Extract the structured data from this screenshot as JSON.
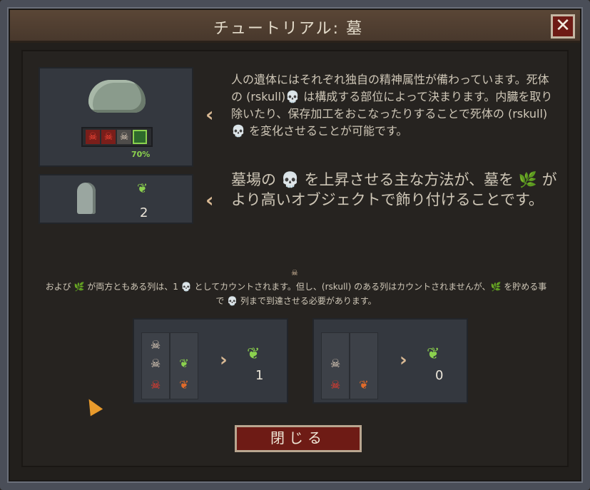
{
  "window": {
    "title": "チュートリアル: 墓",
    "close_symbol": "✕"
  },
  "corpse_panel": {
    "slots": [
      "red-skull",
      "red-skull",
      "grey-skull",
      "green-bar"
    ],
    "percent": "70%"
  },
  "grave_panel": {
    "value": "2"
  },
  "descriptions": {
    "line1": "人の遺体にはそれぞれ独自の精神属性が備わっています。死体の (rskull)💀 は構成する部位によって決まります。内臓を取り除いたり、保存加工をおこなったりすることで死体の (rskull)💀 を変化させることが可能です。",
    "line2": "墓場の 💀 を上昇させる主な方法が、墓を 🌿 がより高いオブジェクトで飾り付けることです。"
  },
  "note": {
    "text": "および 🌿 が両方ともある列は、1 💀 としてカウントされます。但し、(rskull) のある列はカウントされませんが、🌿 を貯める事で 💀 列まで到達させる必要があります。"
  },
  "examples": [
    {
      "result": "1"
    },
    {
      "result": "0"
    }
  ],
  "buttons": {
    "close_label": "閉じる"
  },
  "colors": {
    "accent_red": "#6e1b15",
    "laurel_green": "#8bd14e",
    "text": "#cfc7b7"
  }
}
